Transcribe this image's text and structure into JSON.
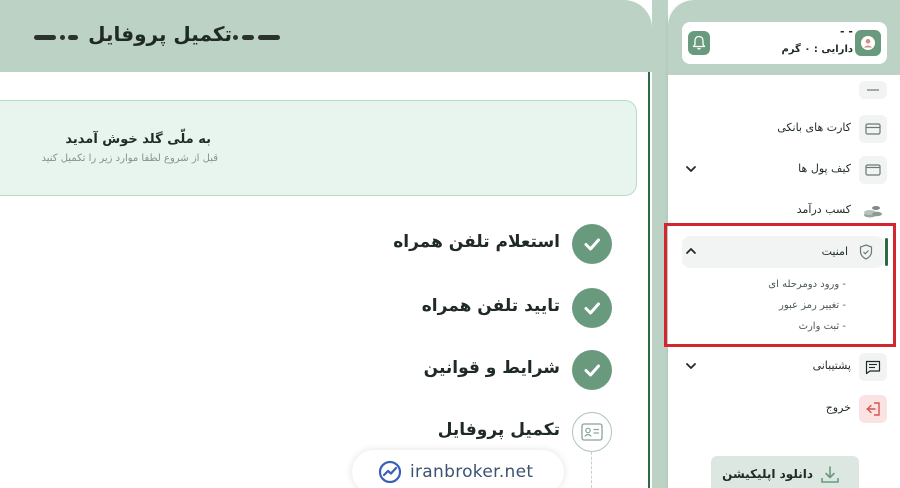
{
  "page": {
    "title": "تکمیل پروفایل"
  },
  "welcome": {
    "title": "به ملّی گلد خوش آمدید",
    "subtitle": "قبل از شروع لطفا موارد زیر را تکمیل کنید"
  },
  "steps": [
    {
      "label": "استعلام تلفن همراه",
      "status": "done"
    },
    {
      "label": "تایید تلفن همراه",
      "status": "done"
    },
    {
      "label": "شرایط و قوانین",
      "status": "done"
    },
    {
      "label": "تکمیل پروفایل",
      "status": "pending"
    }
  ],
  "watermark": {
    "text": "iranbroker.net"
  },
  "user": {
    "name": "- -",
    "assets": "دارایی : ۰ گرم"
  },
  "menu": {
    "bank_cards": "کارت های بانکی",
    "wallets": "کیف پول ها",
    "income": "کسب درآمد",
    "security": "امنیت",
    "security_sub": [
      "- ورود دومرحله ای",
      "- تغییر رمز عبور",
      "- ثبت وارث"
    ],
    "support": "پشتیبانی",
    "logout": "خروج"
  },
  "download": {
    "label": "دانلود اپلیکیشن"
  },
  "colors": {
    "brand_green": "#6a9a7e",
    "header_green": "#bcd2c5",
    "highlight_red": "#d3262f",
    "logout_red": "#d9534f"
  }
}
